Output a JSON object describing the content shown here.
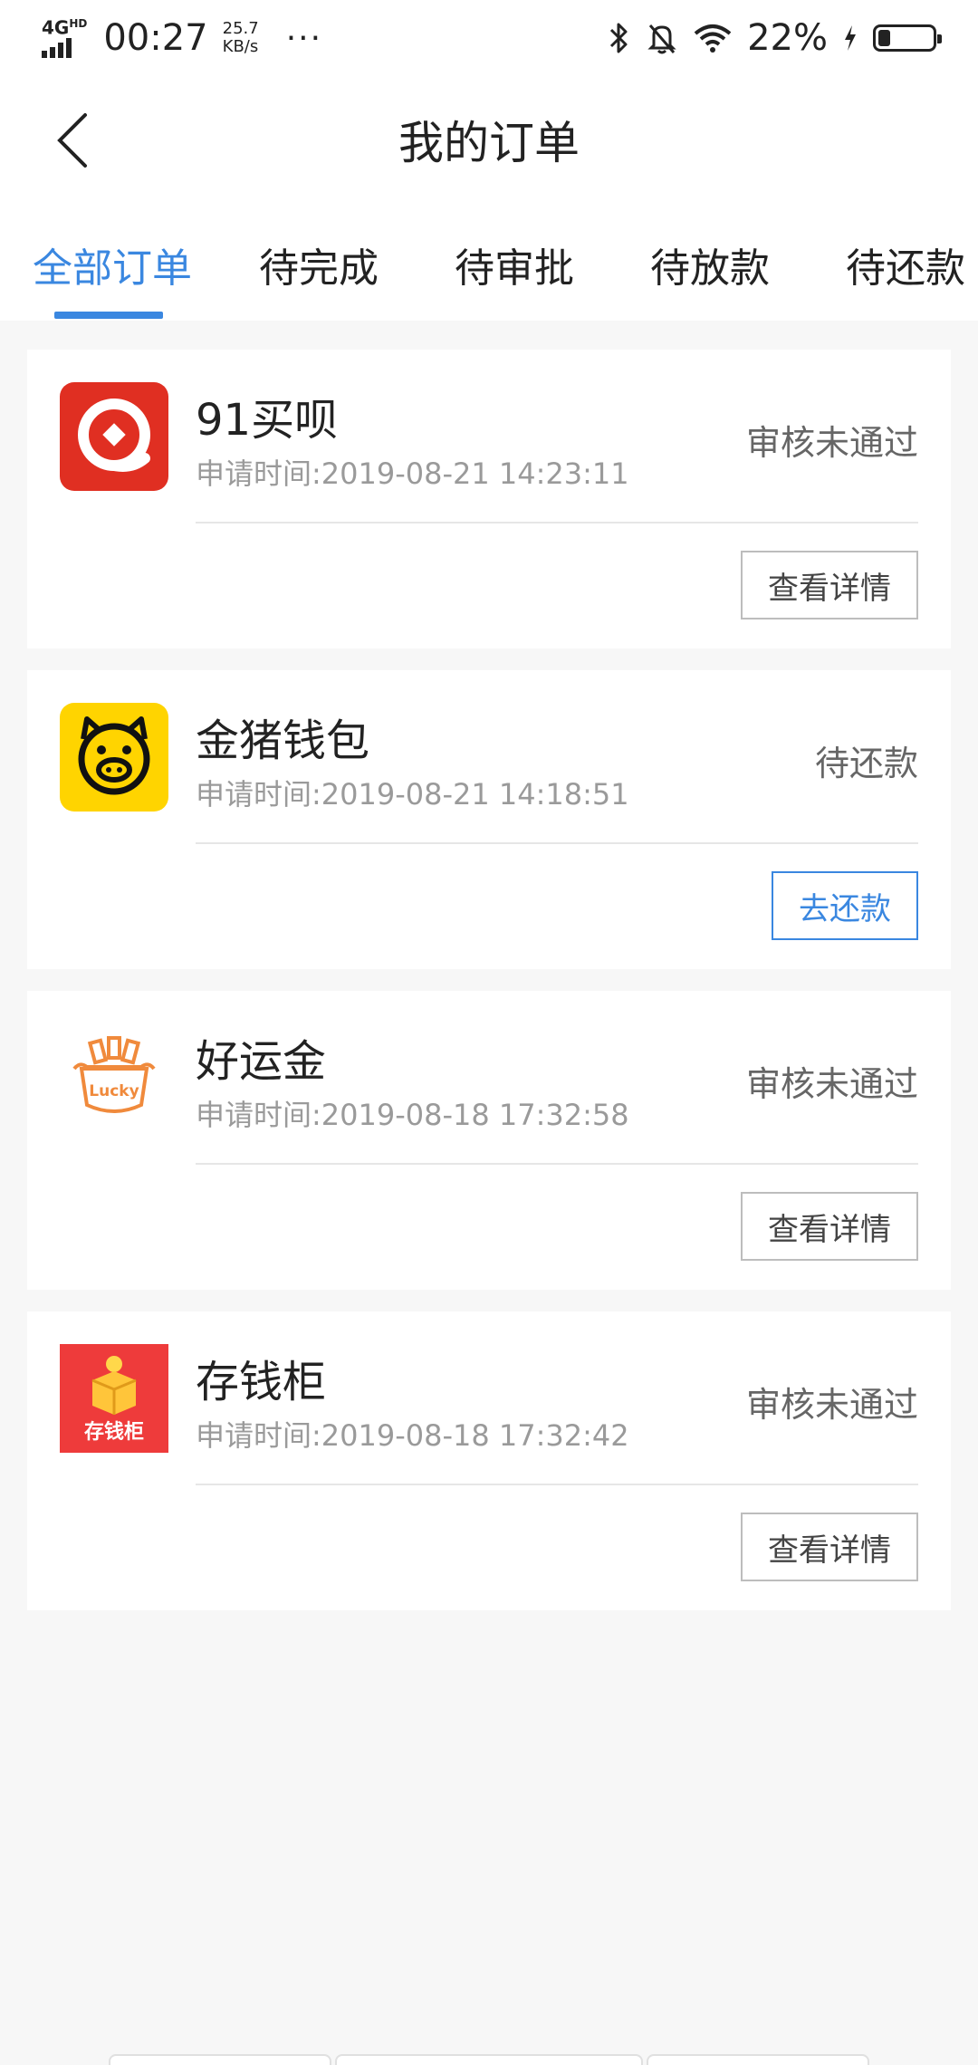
{
  "statusbar": {
    "network": "4G",
    "network_sup": "HD",
    "time": "00:27",
    "speed_value": "25.7",
    "speed_unit": "KB/s",
    "more": "···",
    "battery": "22%",
    "battery_level": 0.22
  },
  "header": {
    "title": "我的订单"
  },
  "tabs": [
    {
      "label": "全部订单"
    },
    {
      "label": "待完成"
    },
    {
      "label": "待审批"
    },
    {
      "label": "待放款"
    },
    {
      "label": "待还款"
    }
  ],
  "orders": [
    {
      "name": "91买呗",
      "time": "申请时间:2019-08-21 14:23:11",
      "status": "审核未通过",
      "action": "查看详情",
      "logo_color": "#e02f22"
    },
    {
      "name": "金猪钱包",
      "time": "申请时间:2019-08-21 14:18:51",
      "status": "待还款",
      "action": "去还款",
      "logo_color": "#ffd400"
    },
    {
      "name": "好运金",
      "time": "申请时间:2019-08-18 17:32:58",
      "status": "审核未通过",
      "action": "查看详情",
      "logo_color": "#f08a3c",
      "logo_text": "Lucky"
    },
    {
      "name": "存钱柜",
      "time": "申请时间:2019-08-18 17:32:42",
      "status": "审核未通过",
      "action": "查看详情",
      "logo_color": "#ee3b3b",
      "logo_text": "存钱柜"
    }
  ],
  "colors": {
    "accent": "#3a87e0"
  }
}
